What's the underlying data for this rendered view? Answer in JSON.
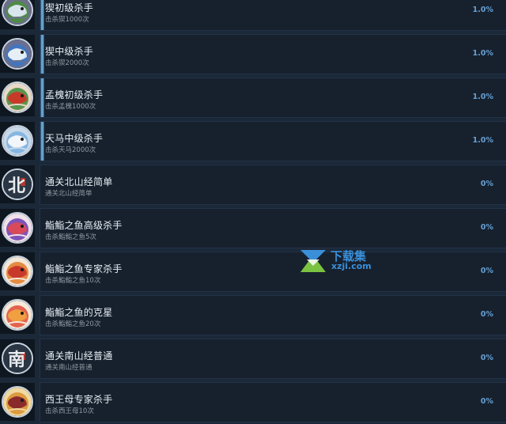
{
  "achievements": [
    {
      "name": "猰初级杀手",
      "desc": "击杀猰1000次",
      "percent": "1.0%",
      "fill": 0.01,
      "icon": "gray-beast-icon",
      "colors": [
        "#4a8f3c",
        "#d8e4ec",
        "#6b6f8a"
      ]
    },
    {
      "name": "猰中级杀手",
      "desc": "击杀猰2000次",
      "percent": "1.0%",
      "fill": 0.01,
      "icon": "gray-beast-icon",
      "colors": [
        "#3a78c8",
        "#e6eef6",
        "#6a6f90"
      ]
    },
    {
      "name": "孟槐初级杀手",
      "desc": "击杀孟槐1000次",
      "percent": "1.0%",
      "fill": 0.01,
      "icon": "red-beast-icon",
      "colors": [
        "#3f8a3a",
        "#c83a2a",
        "#e8d8c8"
      ]
    },
    {
      "name": "天马中级杀手",
      "desc": "击杀天马2000次",
      "percent": "1.0%",
      "fill": 0.01,
      "icon": "white-horse-icon",
      "colors": [
        "#7ab0e0",
        "#f2f6fa",
        "#c8d8e8"
      ]
    },
    {
      "name": "通关北山经简单",
      "desc": "通关北山经简单",
      "percent": "0%",
      "fill": 0,
      "icon": "bei-calligraphy-icon",
      "glyph": "北",
      "colors": [
        "#2a3644",
        "#e8ecef",
        "#b03a30"
      ]
    },
    {
      "name": "鮨鮨之鱼高级杀手",
      "desc": "击杀鮨鮨之鱼5次",
      "percent": "0%",
      "fill": 0,
      "icon": "purple-fish-beast-icon",
      "colors": [
        "#6a3ab0",
        "#d84a5a",
        "#f0e0e8"
      ]
    },
    {
      "name": "鮨鮨之鱼专家杀手",
      "desc": "击杀鮨鮨之鱼10次",
      "percent": "0%",
      "fill": 0,
      "icon": "orange-fish-beast-icon",
      "colors": [
        "#e07a2a",
        "#c83a2a",
        "#f4e8d8"
      ]
    },
    {
      "name": "鮨鮨之鱼的克星",
      "desc": "击杀鮨鮨之鱼20次",
      "percent": "0%",
      "fill": 0,
      "icon": "red-fish-beast-icon",
      "colors": [
        "#e04a3a",
        "#f0a040",
        "#f6ead8"
      ]
    },
    {
      "name": "通关南山经普通",
      "desc": "通关南山经普通",
      "percent": "0%",
      "fill": 0,
      "icon": "nan-calligraphy-icon",
      "glyph": "南",
      "colors": [
        "#2a3644",
        "#e8ecef",
        "#b03a30"
      ]
    },
    {
      "name": "西王母专家杀手",
      "desc": "击杀西王母10次",
      "percent": "0%",
      "fill": 0,
      "icon": "queen-mother-icon",
      "colors": [
        "#d89030",
        "#8a2a2a",
        "#f0d8a0"
      ]
    }
  ],
  "watermark": {
    "title": "下载集",
    "url": "xzji.com",
    "colors": [
      "#3a8fd8",
      "#7cc242"
    ]
  }
}
